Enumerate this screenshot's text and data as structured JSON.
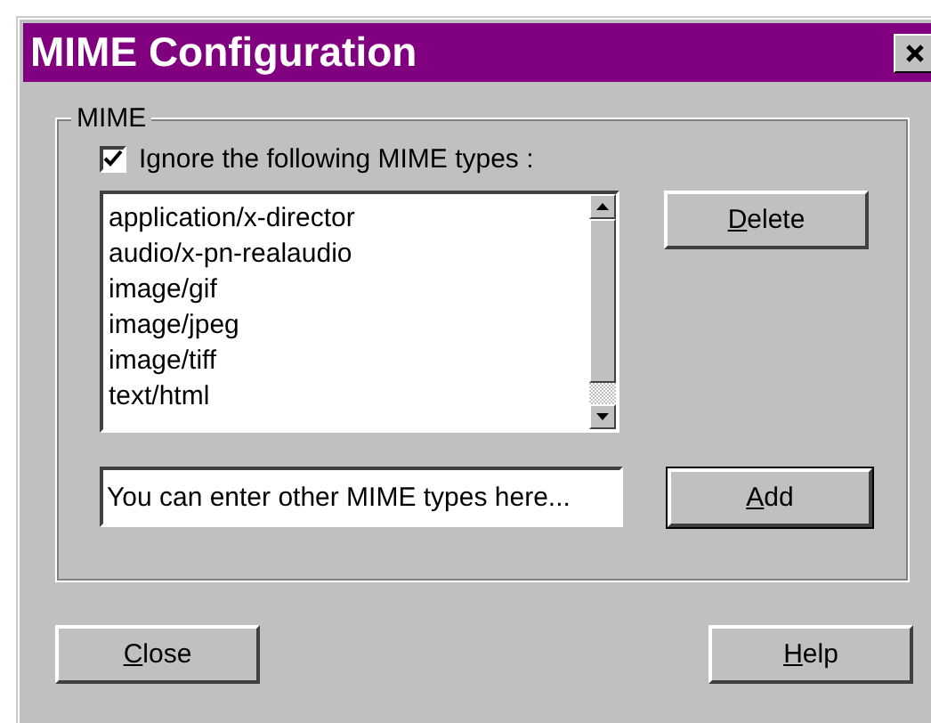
{
  "window": {
    "title": "MIME Configuration"
  },
  "group": {
    "label": "MIME"
  },
  "ignore": {
    "label": "Ignore the following MIME types :",
    "checked": true
  },
  "mime_types": [
    "application/x-director",
    "audio/x-pn-realaudio",
    "image/gif",
    "image/jpeg",
    "image/tiff",
    "text/html"
  ],
  "delete_button": {
    "label": "Delete"
  },
  "new_type": {
    "value": "You can enter other MIME types here..."
  },
  "add_button": {
    "label": "Add",
    "default": true
  },
  "footer_buttons": [
    {
      "label": "Close"
    },
    {
      "label": "Help"
    }
  ]
}
